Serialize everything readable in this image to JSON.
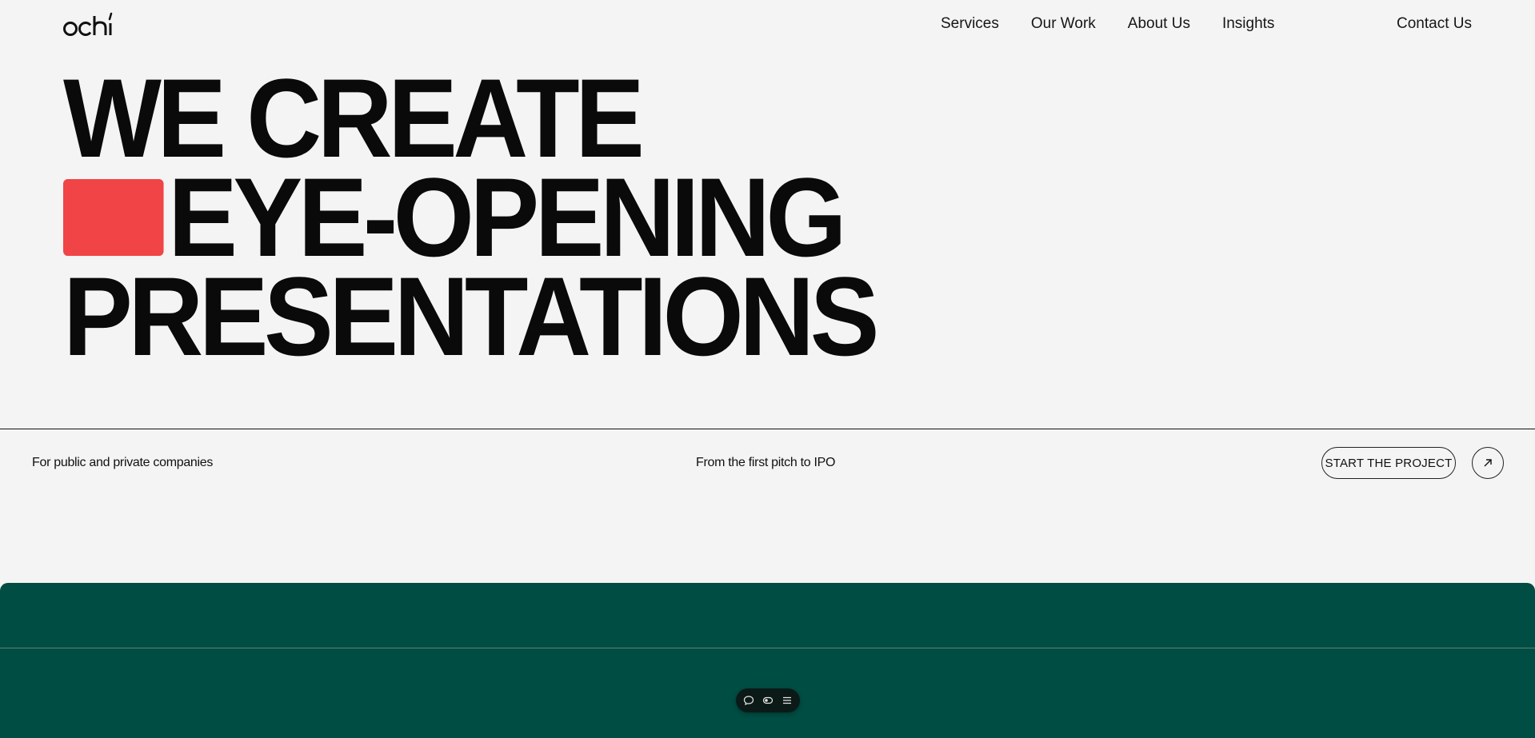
{
  "header": {
    "logo_text": "ochi",
    "nav": [
      "Services",
      "Our Work",
      "About Us",
      "Insights"
    ],
    "contact_label": "Contact Us"
  },
  "hero": {
    "line1": "WE CREATE",
    "line2": "EYE-OPENING",
    "line3": "PRESENTATIONS",
    "accent_color": "#f04446"
  },
  "subbar": {
    "left_text": "For public and private companies",
    "mid_text": "From the first pitch to IPO",
    "cta_label": "START THE PROJECT",
    "cta_icon": "arrow-up-right-icon"
  },
  "footer_section": {
    "background_color": "#004d43"
  },
  "floating_toolbar": {
    "icons": [
      "chat-icon",
      "toggle-icon",
      "menu-icon"
    ]
  }
}
